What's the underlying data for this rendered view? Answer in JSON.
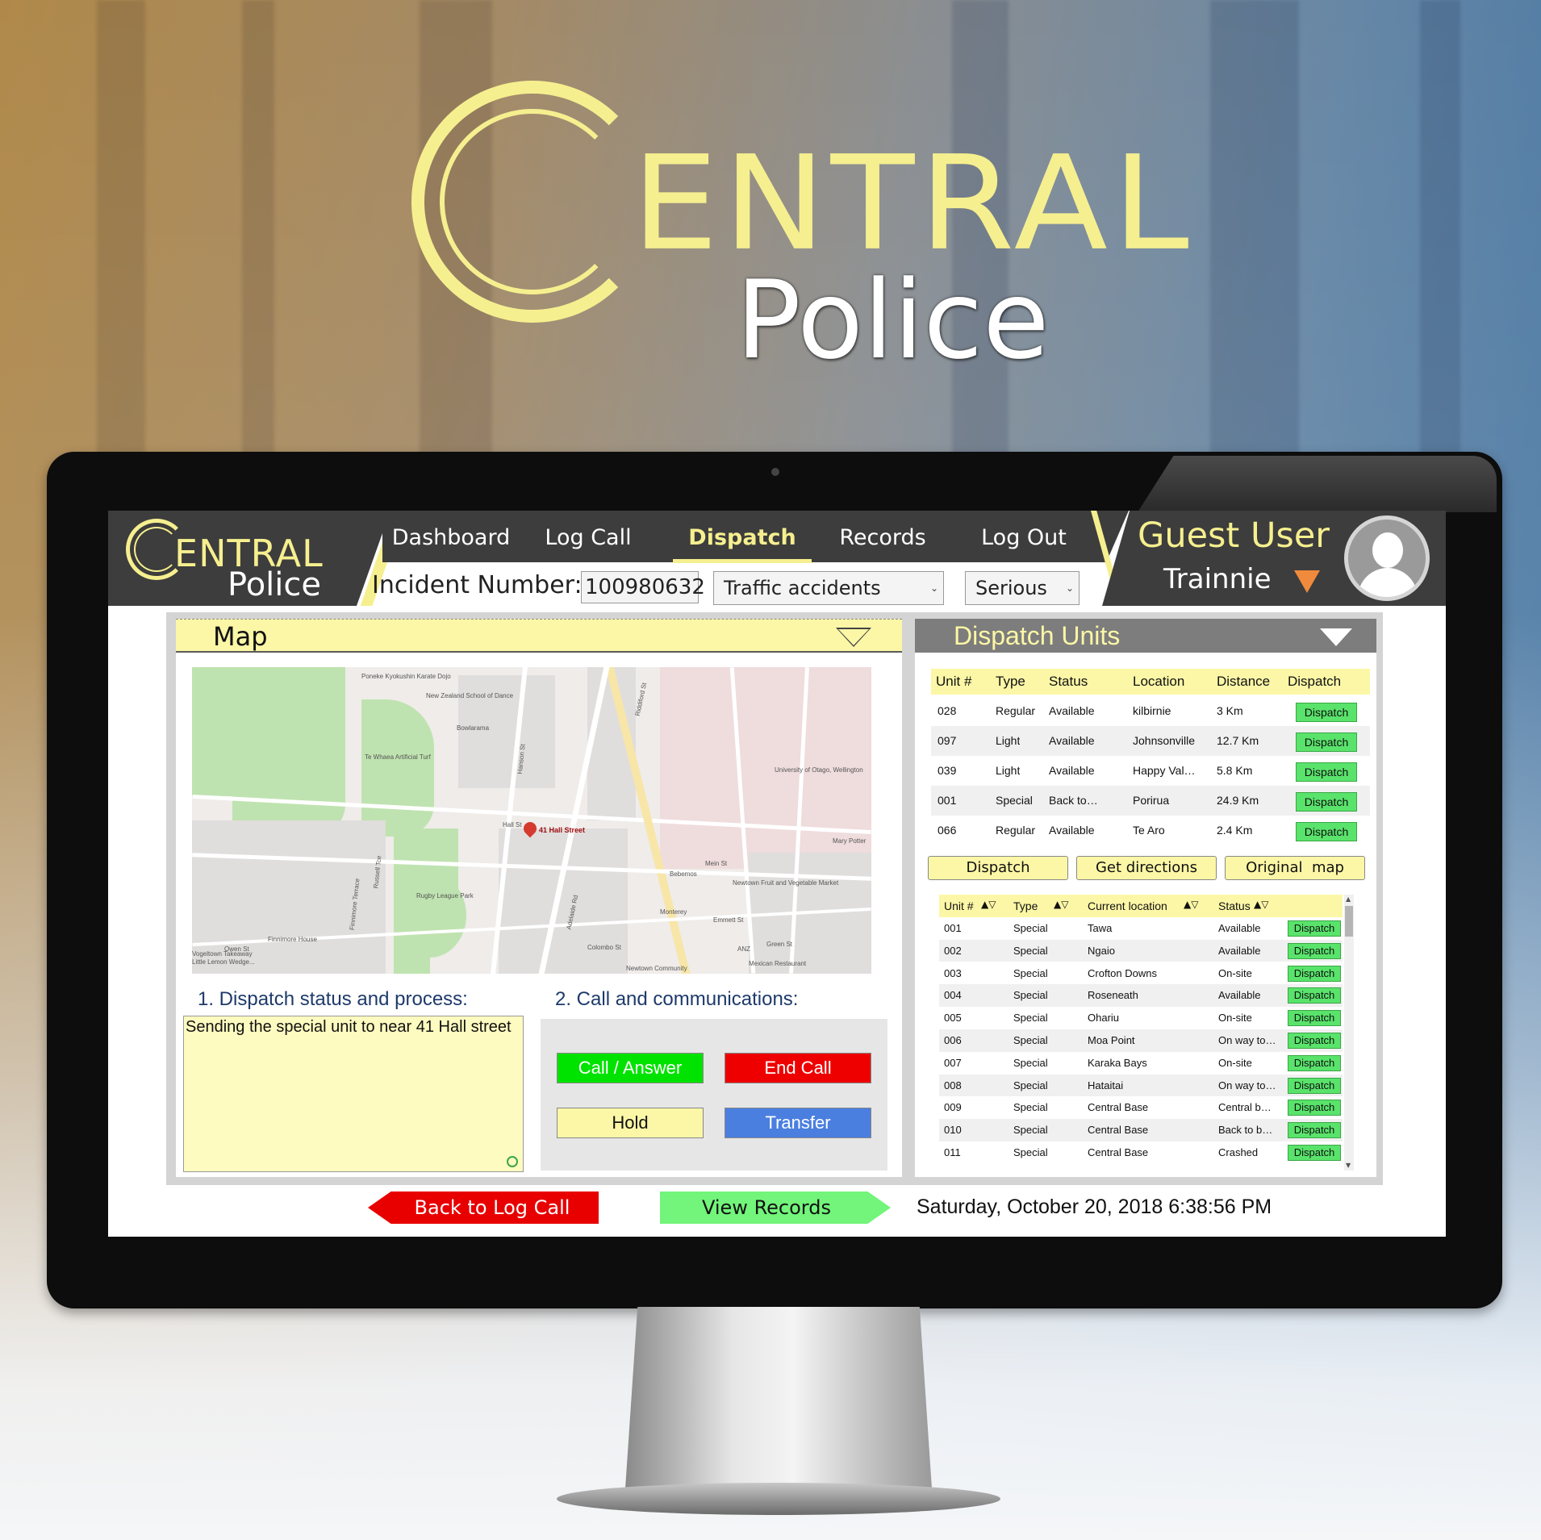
{
  "hero": {
    "logo_main": "ENTRAL",
    "logo_sub": "Police"
  },
  "app": {
    "logo_main": "ENTRAL",
    "logo_sub": "Police"
  },
  "nav": {
    "items": [
      "Dashboard",
      "Log Call",
      "Dispatch",
      "Records",
      "Log Out"
    ],
    "active": "Dispatch"
  },
  "incident": {
    "label": "Incident Number:",
    "number": "100980632",
    "type": "Traffic accidents",
    "severity": "Serious"
  },
  "user": {
    "name": "Guest User",
    "role": "Trainnie"
  },
  "map_panel": {
    "title": "Map",
    "pin_label": "41 Hall Street",
    "labels": [
      "Poneke Kyokushin Karate Dojo",
      "New Zealand School of Dance",
      "Bowlarama",
      "Te Whaea Artificial Turf",
      "University of Otago, Wellington",
      "Hall St",
      "Rugby League Park",
      "Bebemos",
      "Newtown Fruit and Vegetable Market",
      "Monterey",
      "Mary Potter",
      "Finnimore House",
      "Vogeltown Takeaway",
      "Little Lemon Wedge...",
      "Mexican Restaurant",
      "Newtown Community",
      "Adelaide Rd",
      "Riddiford St",
      "ANZ",
      "Emmett St",
      "Green St",
      "Mein St",
      "Colombo St",
      "Owen St",
      "Hanson St",
      "Russell Tce",
      "Finnimore Terrace"
    ]
  },
  "status_section": {
    "title": "1. Dispatch status and process:",
    "text": "Sending the special unit to near 41 Hall street"
  },
  "call_section": {
    "title": "2. Call and communications:",
    "buttons": {
      "answer": "Call / Answer",
      "end": "End Call",
      "hold": "Hold",
      "transfer": "Transfer"
    }
  },
  "dispatch_units": {
    "title": "Dispatch Units",
    "columns": [
      "Unit #",
      "Type",
      "Status",
      "Location",
      "Distance",
      "Dispatch"
    ],
    "rows": [
      {
        "unit": "028",
        "type": "Regular",
        "status": "Available",
        "location": "kilbirnie",
        "distance": "3 Km",
        "action": "Dispatch"
      },
      {
        "unit": "097",
        "type": "Light",
        "status": "Available",
        "location": "Johnsonville",
        "distance": "12.7 Km",
        "action": "Dispatch"
      },
      {
        "unit": "039",
        "type": "Light",
        "status": "Available",
        "location": "Happy Val…",
        "distance": "5.8 Km",
        "action": "Dispatch"
      },
      {
        "unit": "001",
        "type": "Special",
        "status": "Back to…",
        "location": "Porirua",
        "distance": "24.9 Km",
        "action": "Dispatch"
      },
      {
        "unit": "066",
        "type": "Regular",
        "status": "Available",
        "location": "Te Aro",
        "distance": "2.4 Km",
        "action": "Dispatch"
      }
    ],
    "actions": {
      "dispatch": "Dispatch",
      "directions": "Get directions",
      "original_map": "Original  map"
    }
  },
  "unit_list": {
    "columns": [
      "Unit #",
      "Type",
      "Current location",
      "Status"
    ],
    "sort_glyph": "▲▽",
    "rows": [
      {
        "unit": "001",
        "type": "Special",
        "location": "Tawa",
        "status": "Available",
        "action": "Dispatch"
      },
      {
        "unit": "002",
        "type": "Special",
        "location": "Ngaio",
        "status": "Available",
        "action": "Dispatch"
      },
      {
        "unit": "003",
        "type": "Special",
        "location": "Crofton Downs",
        "status": "On-site",
        "action": "Dispatch"
      },
      {
        "unit": "004",
        "type": "Special",
        "location": "Roseneath",
        "status": "Available",
        "action": "Dispatch"
      },
      {
        "unit": "005",
        "type": "Special",
        "location": "Ohariu",
        "status": "On-site",
        "action": "Dispatch"
      },
      {
        "unit": "006",
        "type": "Special",
        "location": "Moa Point",
        "status": "On way to…",
        "action": "Dispatch"
      },
      {
        "unit": "007",
        "type": "Special",
        "location": "Karaka Bays",
        "status": "On-site",
        "action": "Dispatch"
      },
      {
        "unit": "008",
        "type": "Special",
        "location": "Hataitai",
        "status": "On way to…",
        "action": "Dispatch"
      },
      {
        "unit": "009",
        "type": "Special",
        "location": "Central Base",
        "status": "Central b…",
        "action": "Dispatch"
      },
      {
        "unit": "010",
        "type": "Special",
        "location": "Central Base",
        "status": "Back to b…",
        "action": "Dispatch"
      },
      {
        "unit": "011",
        "type": "Special",
        "location": "Central Base",
        "status": "Crashed",
        "action": "Dispatch"
      }
    ]
  },
  "footer": {
    "back": "Back to Log Call",
    "view": "View Records",
    "datetime": "Saturday, October 20, 2018 6:38:56 PM"
  },
  "colors": {
    "brand_yellow": "#f6ef8f",
    "panel_yellow": "#fcf7a6",
    "dark": "#3d3d3d",
    "green": "#59e36b",
    "red": "#e80000",
    "blue": "#4a7fe0"
  }
}
